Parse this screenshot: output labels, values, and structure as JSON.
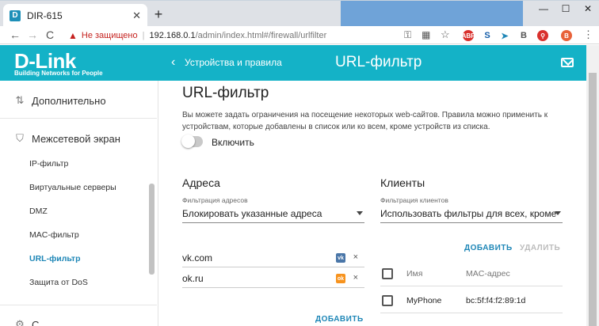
{
  "browser": {
    "tab_title": "DIR-615",
    "tab_favicon": "D",
    "new_tab": "+",
    "min": "—",
    "max": "☐",
    "close": "✕",
    "back": "←",
    "forward": "→",
    "reload": "C",
    "security_icon": "▲",
    "insecure_label": "Не защищено",
    "separator": "|",
    "url_host": "192.168.0.1",
    "url_path": "/admin/index.html#/firewall/urlfilter",
    "key_icon": "⚿",
    "translate_icon": "▦",
    "star_icon": "☆",
    "ext_labels": [
      "ABP",
      "S",
      "➤",
      "B",
      "⚲",
      "B",
      "⋮"
    ],
    "profile_initial": "B"
  },
  "sidebar": {
    "logo": "D-Link",
    "logo_sub": "Building Networks for People",
    "section_more": "Дополнительно",
    "section_firewall": "Межсетевой экран",
    "items": [
      "IP-фильтр",
      "Виртуальные серверы",
      "DMZ",
      "MAC-фильтр",
      "URL-фильтр",
      "Защита от DoS"
    ],
    "section_next": "С"
  },
  "header": {
    "back_icon": "‹",
    "breadcrumb": "Устройства и правила",
    "title": "URL-фильтр"
  },
  "content": {
    "title": "URL-фильтр",
    "description": "Вы можете задать ограничения на посещение некоторых web-сайтов. Правила можно применить к устройствам, которые добавлены в список или ко всем, кроме устройств из списка.",
    "toggle_label": "Включить",
    "toggle_on": false,
    "addresses": {
      "heading": "Адреса",
      "filter_label": "Фильтрация адресов",
      "filter_value": "Блокировать указанные адреса",
      "items": [
        {
          "url": "vk.com",
          "badge": "vk",
          "badge_color": "#4a76a8"
        },
        {
          "url": "ok.ru",
          "badge": "ok",
          "badge_color": "#f7931e"
        }
      ],
      "delete_glyph": "×",
      "add_label": "ДОБАВИТЬ"
    },
    "clients": {
      "heading": "Клиенты",
      "filter_label": "Фильтрация клиентов",
      "filter_value": "Использовать фильтры для всех, кроме",
      "add_label": "ДОБАВИТЬ",
      "delete_label": "УДАЛИТЬ",
      "columns": [
        "Имя",
        "MAC-адрес"
      ],
      "rows": [
        {
          "name": "MyPhone",
          "mac": "bc:5f:f4:f2:89:1d"
        }
      ]
    }
  },
  "colors": {
    "brand": "#14b2c7",
    "link": "#1f87b7",
    "disabled": "#bcbcbc"
  }
}
